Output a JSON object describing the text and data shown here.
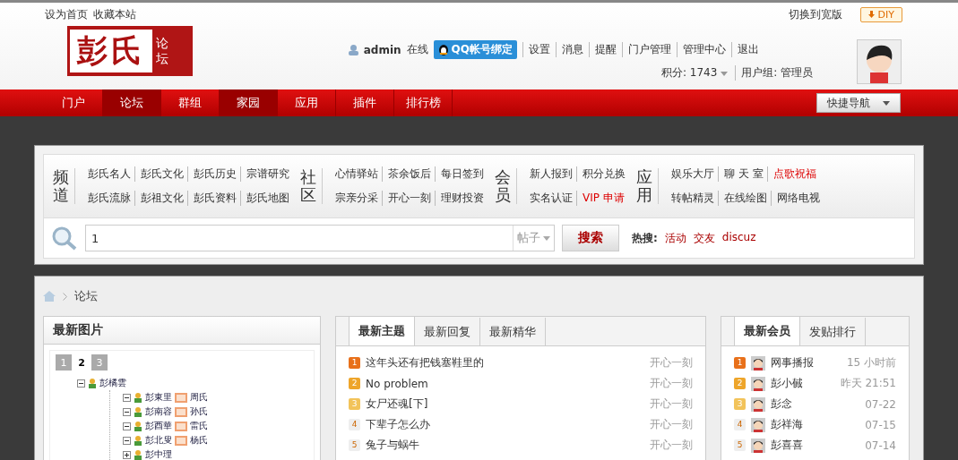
{
  "top_links": [
    "设为首页",
    "收藏本站"
  ],
  "top_right": {
    "widescreen": "切换到宽版",
    "diy": "DIY"
  },
  "logo": {
    "main": "彭氏",
    "side": "论坛"
  },
  "user": {
    "name": "admin",
    "status": "在线",
    "qq_button": "QQ帐号绑定",
    "links": [
      "设置",
      "消息",
      "提醒",
      "门户管理",
      "管理中心",
      "退出"
    ],
    "points": "积分: 1743",
    "group": "用户组: 管理员"
  },
  "nav": [
    {
      "label": "门户",
      "selected": false
    },
    {
      "label": "论坛",
      "selected": true
    },
    {
      "label": "群组",
      "selected": false
    },
    {
      "label": "家园",
      "selected": true
    },
    {
      "label": "应用",
      "selected": false
    },
    {
      "label": "插件",
      "selected": false
    },
    {
      "label": "排行榜",
      "selected": false
    }
  ],
  "quick_nav": "快捷导航",
  "channels": [
    {
      "title": "频道",
      "rows": [
        [
          {
            "label": "彭氏名人",
            "hot": false
          },
          {
            "label": "彭氏文化",
            "hot": false
          },
          {
            "label": "彭氏历史",
            "hot": false
          },
          {
            "label": "宗谱研究",
            "hot": false
          }
        ],
        [
          {
            "label": "彭氏流脉",
            "hot": false
          },
          {
            "label": "彭祖文化",
            "hot": false
          },
          {
            "label": "彭氏资料",
            "hot": false
          },
          {
            "label": "彭氏地图",
            "hot": false
          }
        ]
      ]
    },
    {
      "title": "社区",
      "rows": [
        [
          {
            "label": "心情驿站",
            "hot": false
          },
          {
            "label": "茶余饭后",
            "hot": false
          },
          {
            "label": "每日签到",
            "hot": false
          }
        ],
        [
          {
            "label": "宗亲分采",
            "hot": false
          },
          {
            "label": "开心一刻",
            "hot": false
          },
          {
            "label": "理财投资",
            "hot": false
          }
        ]
      ]
    },
    {
      "title": "会员",
      "rows": [
        [
          {
            "label": "新人报到",
            "hot": false
          },
          {
            "label": "积分兑换",
            "hot": false
          }
        ],
        [
          {
            "label": "实名认证",
            "hot": false
          },
          {
            "label": "VIP 申请",
            "hot": true
          }
        ]
      ]
    },
    {
      "title": "应用",
      "rows": [
        [
          {
            "label": "娱乐大厅",
            "hot": false
          },
          {
            "label": "聊 天 室",
            "hot": false
          },
          {
            "label": "点歌祝福",
            "hot": true
          }
        ],
        [
          {
            "label": "转帖精灵",
            "hot": false
          },
          {
            "label": "在线绘图",
            "hot": false
          },
          {
            "label": "网络电视",
            "hot": false
          }
        ]
      ]
    }
  ],
  "search": {
    "value": "1",
    "type": "帖子",
    "button": "搜索",
    "hot_label": "热搜:",
    "hot": [
      "活动",
      "交友",
      "discuz"
    ]
  },
  "breadcrumb": "论坛",
  "pictures": {
    "title": "最新图片",
    "pages": [
      {
        "label": "1",
        "selected": false
      },
      {
        "label": "2",
        "selected": true
      },
      {
        "label": "3",
        "selected": false
      }
    ],
    "tree": [
      {
        "name": "彭橘雲",
        "expanded": true,
        "children": [
          {
            "name": "彭東里",
            "expanded": true,
            "spouse": "周氏"
          },
          {
            "name": "彭南容",
            "expanded": true,
            "spouse": "孙氏"
          },
          {
            "name": "彭酉華",
            "expanded": true,
            "spouse": "雷氏"
          },
          {
            "name": "彭北叟",
            "expanded": true,
            "spouse": "杨氏"
          },
          {
            "name": "彭中理",
            "expanded": false
          }
        ]
      }
    ]
  },
  "threads": {
    "tabs": [
      {
        "label": "最新主题",
        "selected": true
      },
      {
        "label": "最新回复",
        "selected": false
      },
      {
        "label": "最新精华",
        "selected": false
      }
    ],
    "items": [
      {
        "rank": "1",
        "color": "#e8701a",
        "title": "这年头还有把钱塞鞋里的",
        "forum": "开心一刻"
      },
      {
        "rank": "2",
        "color": "#eea52a",
        "title": "No problem",
        "forum": "开心一刻"
      },
      {
        "rank": "3",
        "color": "#f2c35a",
        "title": "女尸还魂[下]",
        "forum": "开心一刻"
      },
      {
        "rank": "4",
        "color": "#eeeeee",
        "title": "下辈子怎么办",
        "forum": "开心一刻"
      },
      {
        "rank": "5",
        "color": "#eeeeee",
        "title": "兔子与蜗牛",
        "forum": "开心一刻"
      }
    ]
  },
  "members": {
    "tabs": [
      {
        "label": "最新会员",
        "selected": true
      },
      {
        "label": "发贴排行",
        "selected": false
      }
    ],
    "items": [
      {
        "rank": "1",
        "color": "#e8701a",
        "name": "网事播报",
        "time": "15 小时前"
      },
      {
        "rank": "2",
        "color": "#eea52a",
        "name": "彭小戫",
        "time": "昨天 21:51"
      },
      {
        "rank": "3",
        "color": "#f2c35a",
        "name": "彭念",
        "time": "07-22"
      },
      {
        "rank": "4",
        "color": "#eeeeee",
        "name": "彭祥海",
        "time": "07-15"
      },
      {
        "rank": "5",
        "color": "#eeeeee",
        "name": "彭喜喜",
        "time": "07-14"
      }
    ]
  }
}
